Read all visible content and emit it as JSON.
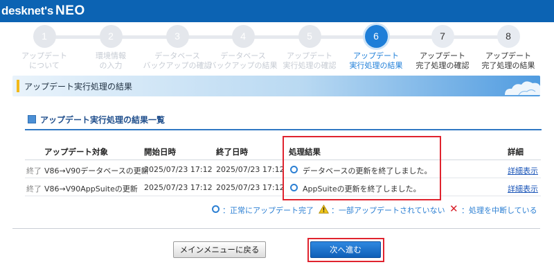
{
  "app": {
    "logo_main": "desknet's",
    "logo_sub": "NEO"
  },
  "steps": [
    {
      "number": "1",
      "line1": "アップデート",
      "line2": "について",
      "state": "done"
    },
    {
      "number": "2",
      "line1": "環境情報",
      "line2": "の入力",
      "state": "done"
    },
    {
      "number": "3",
      "line1": "データベース",
      "line2": "バックアップの確認",
      "state": "done"
    },
    {
      "number": "4",
      "line1": "データベース",
      "line2": "バックアップの結果",
      "state": "done"
    },
    {
      "number": "5",
      "line1": "アップデート",
      "line2": "実行処理の確認",
      "state": "done"
    },
    {
      "number": "6",
      "line1": "アップデート",
      "line2": "実行処理の結果",
      "state": "current"
    },
    {
      "number": "7",
      "line1": "アップデート",
      "line2": "完了処理の確認",
      "state": "future"
    },
    {
      "number": "8",
      "line1": "アップデート",
      "line2": "完了処理の結果",
      "state": "future"
    }
  ],
  "page": {
    "title": "アップデート実行処理の結果"
  },
  "section": {
    "title": "アップデート実行処理の結果一覧"
  },
  "table": {
    "headers": {
      "target": "アップデート対象",
      "start": "開始日時",
      "end": "終了日時",
      "result": "処理結果",
      "detail": "詳細"
    },
    "rows": [
      {
        "status": "終了",
        "target": "V86→V90データベースの更新",
        "start": "2025/07/23 17:12",
        "end": "2025/07/23 17:12",
        "result": "データベースの更新を終了しました。",
        "detail": "詳細表示"
      },
      {
        "status": "終了",
        "target": "V86→V90AppSuiteの更新",
        "start": "2025/07/23 17:12",
        "end": "2025/07/23 17:12",
        "result": "AppSuiteの更新を終了しました。",
        "detail": "詳細表示"
      }
    ]
  },
  "legend": {
    "ok": "：正常にアップデート完了",
    "warn": "：一部アップデートされていない",
    "ng": "：処理を中断している"
  },
  "buttons": {
    "back": "メインメニューに戻る",
    "next": "次へ進む"
  },
  "colors": {
    "header": "#0c63b3",
    "accent": "#1d7ed8",
    "highlight": "#e0232e",
    "warn": "#f2c71a",
    "error": "#d8202a"
  }
}
